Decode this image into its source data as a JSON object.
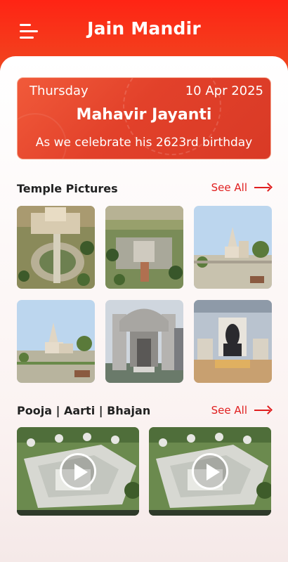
{
  "header": {
    "title": "Jain Mandir",
    "menu_icon": "hamburger-menu-icon"
  },
  "banner": {
    "day": "Thursday",
    "date": "10 Apr 2025",
    "festival": "Mahavir Jayanti",
    "subtitle": "As we celebrate his 2623rd birthday"
  },
  "temple_pictures": {
    "title": "Temple Pictures",
    "see_all": "See All",
    "items": [
      "temple-aerial-garden",
      "temple-aerial-complex",
      "temple-spire-garden",
      "temple-spire-trees",
      "temple-carved-gate",
      "temple-idol-interior"
    ]
  },
  "pooja": {
    "title": "Pooja |  Aarti | Bhajan",
    "see_all": "See All",
    "videos": [
      "pooja-video-1",
      "pooja-video-2"
    ]
  },
  "colors": {
    "accent": "#e01e1e",
    "header": "#ff2414",
    "banner": "#e2412a"
  }
}
